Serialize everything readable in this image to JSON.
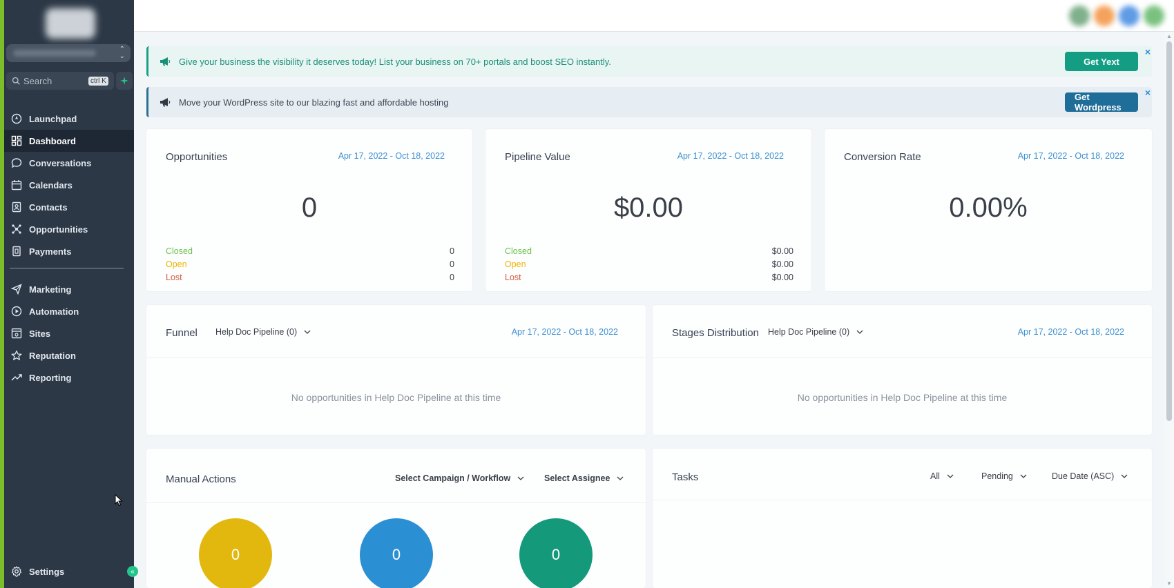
{
  "sidebar": {
    "search_placeholder": "Search",
    "search_shortcut": "ctrl K",
    "items": [
      {
        "label": "Launchpad",
        "icon": "launchpad-icon"
      },
      {
        "label": "Dashboard",
        "icon": "dashboard-icon",
        "active": true
      },
      {
        "label": "Conversations",
        "icon": "chat-bubble-icon"
      },
      {
        "label": "Calendars",
        "icon": "calendar-icon"
      },
      {
        "label": "Contacts",
        "icon": "contacts-icon"
      },
      {
        "label": "Opportunities",
        "icon": "opportunities-icon"
      },
      {
        "label": "Payments",
        "icon": "payments-icon"
      }
    ],
    "items2": [
      {
        "label": "Marketing",
        "icon": "send-icon"
      },
      {
        "label": "Automation",
        "icon": "automation-icon"
      },
      {
        "label": "Sites",
        "icon": "sites-icon"
      },
      {
        "label": "Reputation",
        "icon": "star-icon"
      },
      {
        "label": "Reporting",
        "icon": "trend-icon"
      }
    ],
    "settings_label": "Settings"
  },
  "banners": {
    "yext": {
      "text": "Give your business the visibility it deserves today! List your business on 70+ portals and boost SEO instantly.",
      "button": "Get Yext",
      "close": "×"
    },
    "wordpress": {
      "text": "Move your WordPress site to our blazing fast and affordable hosting",
      "button": "Get Wordpress",
      "close": "×"
    }
  },
  "stats": {
    "opportunities": {
      "title": "Opportunities",
      "date": "Apr 17, 2022 - Oct 18, 2022",
      "value": "0",
      "rows": [
        {
          "label": "Closed",
          "value": "0"
        },
        {
          "label": "Open",
          "value": "0"
        },
        {
          "label": "Lost",
          "value": "0"
        }
      ]
    },
    "pipeline": {
      "title": "Pipeline Value",
      "date": "Apr 17, 2022 - Oct 18, 2022",
      "value": "$0.00",
      "rows": [
        {
          "label": "Closed",
          "value": "$0.00"
        },
        {
          "label": "Open",
          "value": "$0.00"
        },
        {
          "label": "Lost",
          "value": "$0.00"
        }
      ]
    },
    "conversion": {
      "title": "Conversion Rate",
      "date": "Apr 17, 2022 - Oct 18, 2022",
      "value": "0.00%"
    }
  },
  "funnel": {
    "title": "Funnel",
    "pipeline": "Help Doc Pipeline (0)",
    "date": "Apr 17, 2022 - Oct 18, 2022",
    "empty": "No opportunities in Help Doc Pipeline at this time"
  },
  "stages": {
    "title": "Stages Distribution",
    "pipeline": "Help Doc Pipeline (0)",
    "date": "Apr 17, 2022 - Oct 18, 2022",
    "empty": "No opportunities in Help Doc Pipeline at this time"
  },
  "manual_actions": {
    "title": "Manual Actions",
    "campaign_select": "Select Campaign / Workflow",
    "assignee_select": "Select Assignee",
    "circles": [
      {
        "value": "0",
        "color": "#e2b80f"
      },
      {
        "value": "0",
        "color": "#2b8fd3"
      },
      {
        "value": "0",
        "color": "#149a7a"
      }
    ]
  },
  "tasks": {
    "title": "Tasks",
    "filter_all": "All",
    "filter_status": "Pending",
    "sort": "Due Date (ASC)"
  },
  "colors": {
    "sidebar_bg": "#2c3846",
    "accent_green": "#7cbd2a",
    "link_blue": "#3d8fd1"
  }
}
